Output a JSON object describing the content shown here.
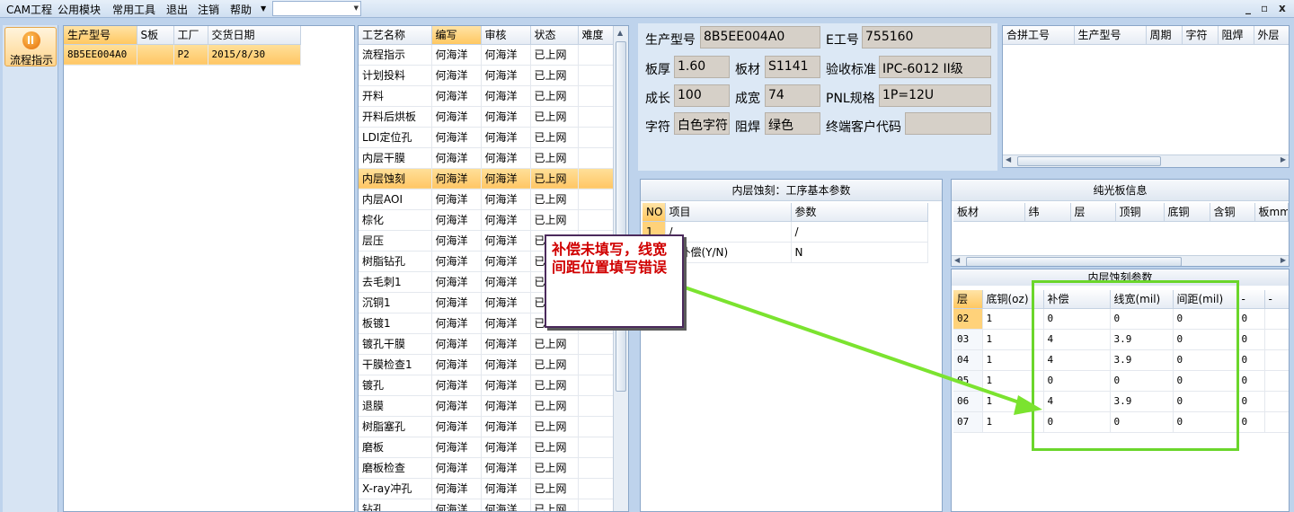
{
  "menu": [
    "CAM工程",
    "公用模块",
    "常用工具",
    "退出",
    "注销",
    "帮助"
  ],
  "window_controls": {
    "minimize": "_",
    "restore": "▫",
    "close": "x"
  },
  "sidebar": {
    "flow_button_label": "流程指示"
  },
  "orders": {
    "headers": [
      "生产型号",
      "S板",
      "工厂",
      "交货日期"
    ],
    "rows": [
      [
        "8B5EE004A0",
        "",
        "P2",
        "2015/8/30"
      ]
    ]
  },
  "process": {
    "headers": [
      "工艺名称",
      "编写",
      "审核",
      "状态",
      "难度"
    ],
    "rows": [
      [
        "流程指示",
        "何海洋",
        "何海洋",
        "已上网",
        ""
      ],
      [
        "计划投料",
        "何海洋",
        "何海洋",
        "已上网",
        ""
      ],
      [
        "开料",
        "何海洋",
        "何海洋",
        "已上网",
        ""
      ],
      [
        "开料后烘板",
        "何海洋",
        "何海洋",
        "已上网",
        ""
      ],
      [
        "LDI定位孔",
        "何海洋",
        "何海洋",
        "已上网",
        ""
      ],
      [
        "内层干膜",
        "何海洋",
        "何海洋",
        "已上网",
        ""
      ],
      [
        "内层蚀刻",
        "何海洋",
        "何海洋",
        "已上网",
        ""
      ],
      [
        "内层AOI",
        "何海洋",
        "何海洋",
        "已上网",
        ""
      ],
      [
        "棕化",
        "何海洋",
        "何海洋",
        "已上网",
        ""
      ],
      [
        "层压",
        "何海洋",
        "何海洋",
        "已上网",
        ""
      ],
      [
        "树脂钻孔",
        "何海洋",
        "何海洋",
        "已上网",
        ""
      ],
      [
        "去毛刺1",
        "何海洋",
        "何海洋",
        "已上网",
        ""
      ],
      [
        "沉铜1",
        "何海洋",
        "何海洋",
        "已上网",
        ""
      ],
      [
        "板镀1",
        "何海洋",
        "何海洋",
        "已上网",
        ""
      ],
      [
        "镀孔干膜",
        "何海洋",
        "何海洋",
        "已上网",
        ""
      ],
      [
        "干膜检查1",
        "何海洋",
        "何海洋",
        "已上网",
        ""
      ],
      [
        "镀孔",
        "何海洋",
        "何海洋",
        "已上网",
        ""
      ],
      [
        "退膜",
        "何海洋",
        "何海洋",
        "已上网",
        ""
      ],
      [
        "树脂塞孔",
        "何海洋",
        "何海洋",
        "已上网",
        ""
      ],
      [
        "磨板",
        "何海洋",
        "何海洋",
        "已上网",
        ""
      ],
      [
        "磨板检查",
        "何海洋",
        "何海洋",
        "已上网",
        ""
      ],
      [
        "X-ray冲孔",
        "何海洋",
        "何海洋",
        "已上网",
        ""
      ],
      [
        "钻孔",
        "何海洋",
        "何海洋",
        "已上网",
        ""
      ]
    ],
    "selected_index": 6
  },
  "info": {
    "model_label": "生产型号",
    "model_value": "8B5EE004A0",
    "eno_label": "E工号",
    "eno_value": "755160",
    "thickness_label": "板厚",
    "thickness_value": "1.60",
    "material_label": "板材",
    "material_value": "S1141",
    "standard_label": "验收标准",
    "standard_value": "IPC-6012 II级",
    "length_label": "成长",
    "length_value": "100",
    "width_label": "成宽",
    "width_value": "74",
    "pnl_label": "PNL规格",
    "pnl_value": "1P=12U",
    "char_label": "字符",
    "char_value": "白色字符",
    "mask_label": "阻焊",
    "mask_value": "绿色",
    "customer_label": "终端客户代码",
    "customer_value": ""
  },
  "combine": {
    "headers": [
      "合拼工号",
      "生产型号",
      "周期",
      "字符",
      "阻焊",
      "外层"
    ]
  },
  "params": {
    "title": "内层蚀刻：工序基本参数",
    "headers": [
      "NO",
      "项目",
      "参数"
    ],
    "rows": [
      [
        "1",
        "/",
        "/"
      ],
      [
        "",
        "态补偿(Y/N)",
        "N"
      ]
    ]
  },
  "plain": {
    "title": "纯光板信息",
    "headers": [
      "板材",
      "纬",
      "层",
      "顶铜",
      "底铜",
      "含铜",
      "板mm"
    ]
  },
  "etch": {
    "title": "内层蚀刻参数",
    "headers": [
      "层",
      "底铜(oz)",
      "补偿",
      "线宽(mil)",
      "间距(mil)",
      "-",
      "-"
    ],
    "rows": [
      [
        "02",
        "1",
        "0",
        "0",
        "0",
        "0"
      ],
      [
        "03",
        "1",
        "4",
        "3.9",
        "0",
        "0"
      ],
      [
        "04",
        "1",
        "4",
        "3.9",
        "0",
        "0"
      ],
      [
        "05",
        "1",
        "0",
        "0",
        "0",
        "0"
      ],
      [
        "06",
        "1",
        "4",
        "3.9",
        "0",
        "0"
      ],
      [
        "07",
        "1",
        "0",
        "0",
        "0",
        "0"
      ]
    ]
  },
  "annotation": {
    "text": "补偿未填写，线宽间距位置填写错误",
    "color": "#d00000",
    "box_color": "#6bd62b"
  }
}
